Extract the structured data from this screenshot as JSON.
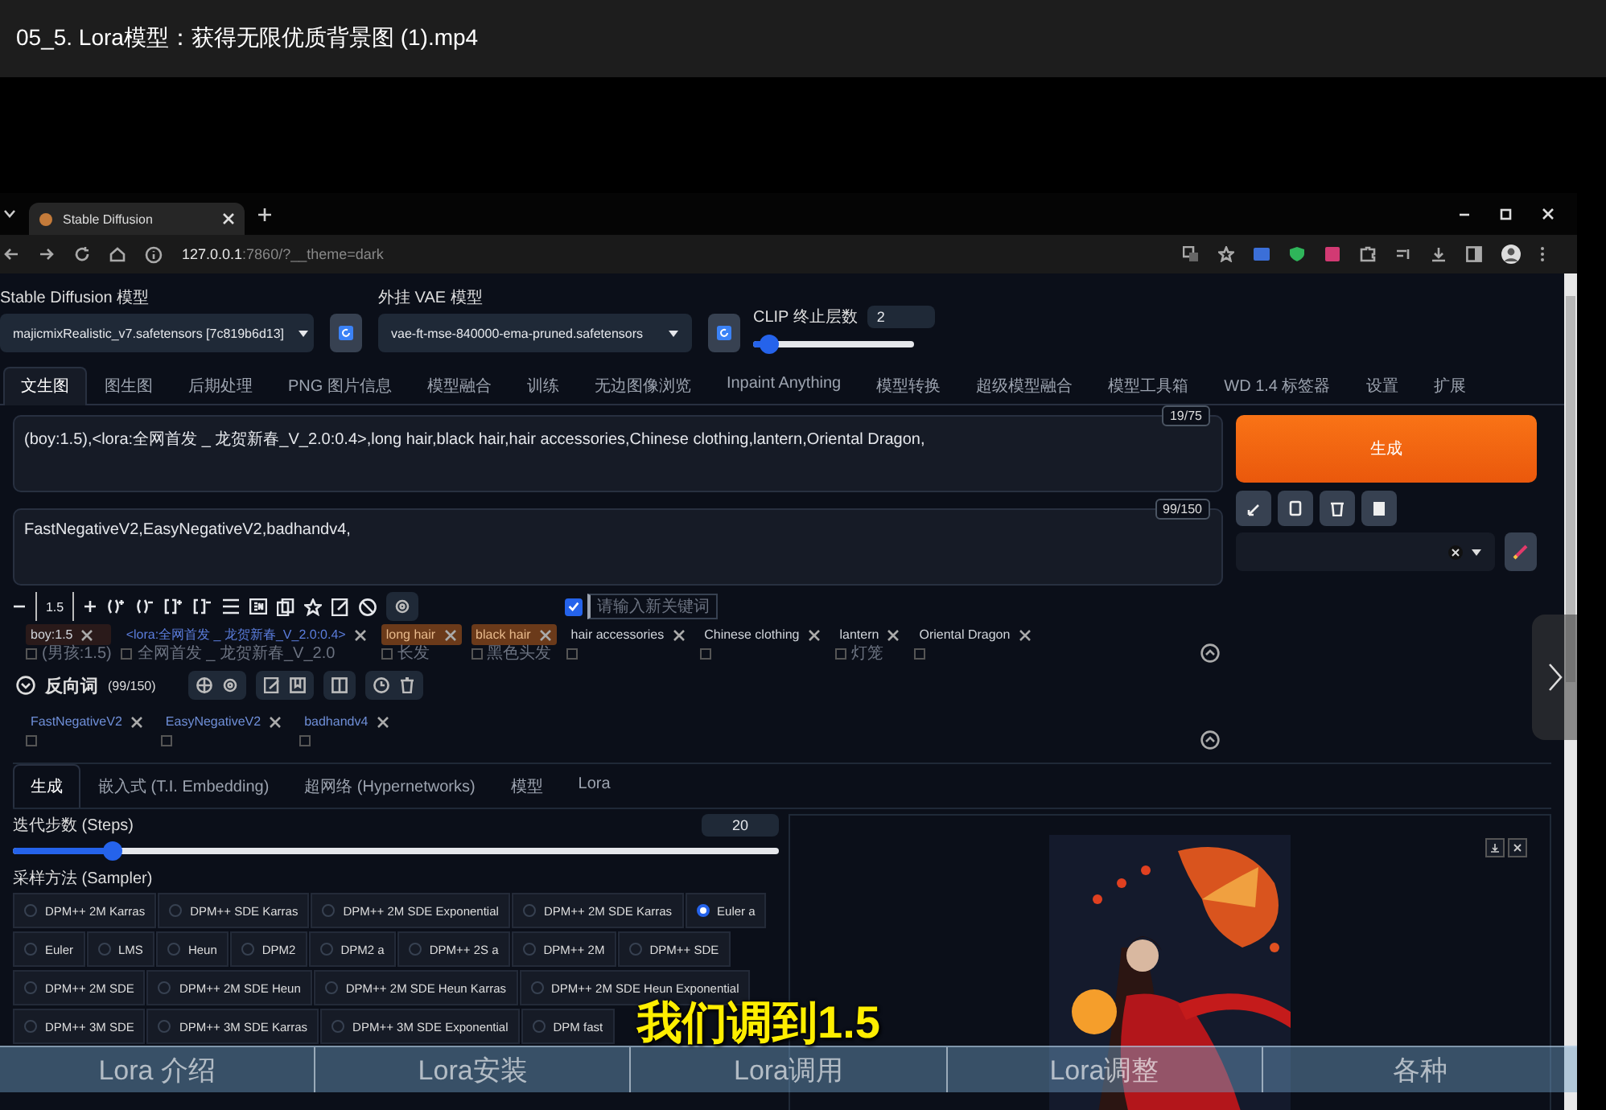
{
  "video_title": "05_5. Lora模型：获得无限优质背景图 (1).mp4",
  "browser": {
    "tab_title": "Stable Diffusion",
    "url_host": "127.0.0.1",
    "url_rest": ":7860/?__theme=dark"
  },
  "model_bar": {
    "sd_model_label": "Stable Diffusion 模型",
    "sd_model": "majicmixRealistic_v7.safetensors [7c819b6d13]",
    "vae_label": "外挂 VAE 模型",
    "vae": "vae-ft-mse-840000-ema-pruned.safetensors",
    "clip": {
      "label": "CLIP 终止层数",
      "value": "2",
      "level": 0.1
    }
  },
  "main_tabs": [
    {
      "label": "文生图",
      "selected": true
    },
    {
      "label": "图生图",
      "selected": false
    },
    {
      "label": "后期处理",
      "selected": false
    },
    {
      "label": "PNG 图片信息",
      "selected": false
    },
    {
      "label": "模型融合",
      "selected": false
    },
    {
      "label": "训练",
      "selected": false
    },
    {
      "label": "无边图像浏览",
      "selected": false
    },
    {
      "label": "Inpaint Anything",
      "selected": false
    },
    {
      "label": "模型转换",
      "selected": false
    },
    {
      "label": "超级模型融合",
      "selected": false
    },
    {
      "label": "模型工具箱",
      "selected": false
    },
    {
      "label": "WD 1.4 标签器",
      "selected": false
    },
    {
      "label": "设置",
      "selected": false
    },
    {
      "label": "扩展",
      "selected": false
    }
  ],
  "prompt": {
    "value": "(boy:1.5),<lora:全网首发 _ 龙贺新春_V_2.0:0.4>,long hair,black hair,hair accessories,Chinese clothing,lantern,Oriental Dragon,",
    "counter": "19/75"
  },
  "negative_prompt": {
    "value": "FastNegativeV2,EasyNegativeV2,badhandv4,",
    "counter": "99/150"
  },
  "generate_button": "生成",
  "prompt_toolbar": {
    "weight_value": "1.5",
    "keyword_checkbox": {
      "placeholder": "请输入新关键词",
      "checked": true
    }
  },
  "tags": [
    {
      "text": "boy:1.5",
      "kind": "weighted",
      "translation": "(男孩:1.5)"
    },
    {
      "text": "<lora:全网首发 _ 龙贺新春_V_2.0:0.4>",
      "kind": "lora",
      "translation": "全网首发 _ 龙贺新春_V_2.0"
    },
    {
      "text": "long hair",
      "kind": "highlighted",
      "translation": "长发"
    },
    {
      "text": "black hair",
      "kind": "highlighted",
      "translation": "黑色头发"
    },
    {
      "text": "hair accessories",
      "kind": "plain"
    },
    {
      "text": "Chinese clothing",
      "kind": "plain"
    },
    {
      "text": "lantern",
      "kind": "plain",
      "translation": "灯笼"
    },
    {
      "text": "Oriental Dragon",
      "kind": "plain"
    }
  ],
  "negative_header": {
    "title": "反向词",
    "counter": "(99/150)"
  },
  "negative_tags": [
    {
      "text": "FastNegativeV2"
    },
    {
      "text": "EasyNegativeV2"
    },
    {
      "text": "badhandv4"
    }
  ],
  "settings_tabs": [
    {
      "label": "生成",
      "selected": true
    },
    {
      "label": "嵌入式 (T.I. Embedding)",
      "selected": false
    },
    {
      "label": "超网络 (Hypernetworks)",
      "selected": false
    },
    {
      "label": "模型",
      "selected": false
    },
    {
      "label": "Lora",
      "selected": false
    }
  ],
  "steps": {
    "label": "迭代步数 (Steps)",
    "value": "20",
    "level": 0.13
  },
  "sampler": {
    "label": "采样方法 (Sampler)",
    "options": [
      {
        "label": "DPM++ 2M Karras",
        "selected": false
      },
      {
        "label": "DPM++ SDE Karras",
        "selected": false
      },
      {
        "label": "DPM++ 2M SDE Exponential",
        "selected": false
      },
      {
        "label": "DPM++ 2M SDE Karras",
        "selected": false
      },
      {
        "label": "Euler a",
        "selected": true
      },
      {
        "label": "Euler",
        "selected": false
      },
      {
        "label": "LMS",
        "selected": false
      },
      {
        "label": "Heun",
        "selected": false
      },
      {
        "label": "DPM2",
        "selected": false
      },
      {
        "label": "DPM2 a",
        "selected": false
      },
      {
        "label": "DPM++ 2S a",
        "selected": false
      },
      {
        "label": "DPM++ 2M",
        "selected": false
      },
      {
        "label": "DPM++ SDE",
        "selected": false
      },
      {
        "label": "DPM++ 2M SDE",
        "selected": false
      },
      {
        "label": "DPM++ 2M SDE Heun",
        "selected": false
      },
      {
        "label": "DPM++ 2M SDE Heun Karras",
        "selected": false
      },
      {
        "label": "DPM++ 2M SDE Heun Exponential",
        "selected": false
      },
      {
        "label": "DPM++ 3M SDE",
        "selected": false
      },
      {
        "label": "DPM++ 3M SDE Karras",
        "selected": false
      },
      {
        "label": "DPM++ 3M SDE Exponential",
        "selected": false
      },
      {
        "label": "DPM fast",
        "selected": false
      }
    ]
  },
  "chapters": [
    "Lora 介绍",
    "Lora安装",
    "Lora调用",
    "Lora调整",
    "各种"
  ],
  "subtitle": "我们调到1.5"
}
